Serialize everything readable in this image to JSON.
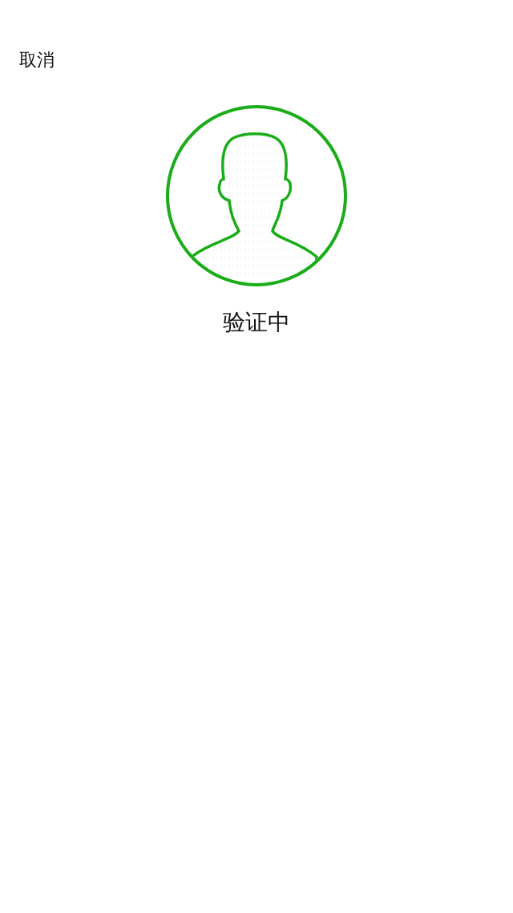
{
  "header": {
    "cancel": "取消"
  },
  "status": {
    "text": "验证中"
  }
}
